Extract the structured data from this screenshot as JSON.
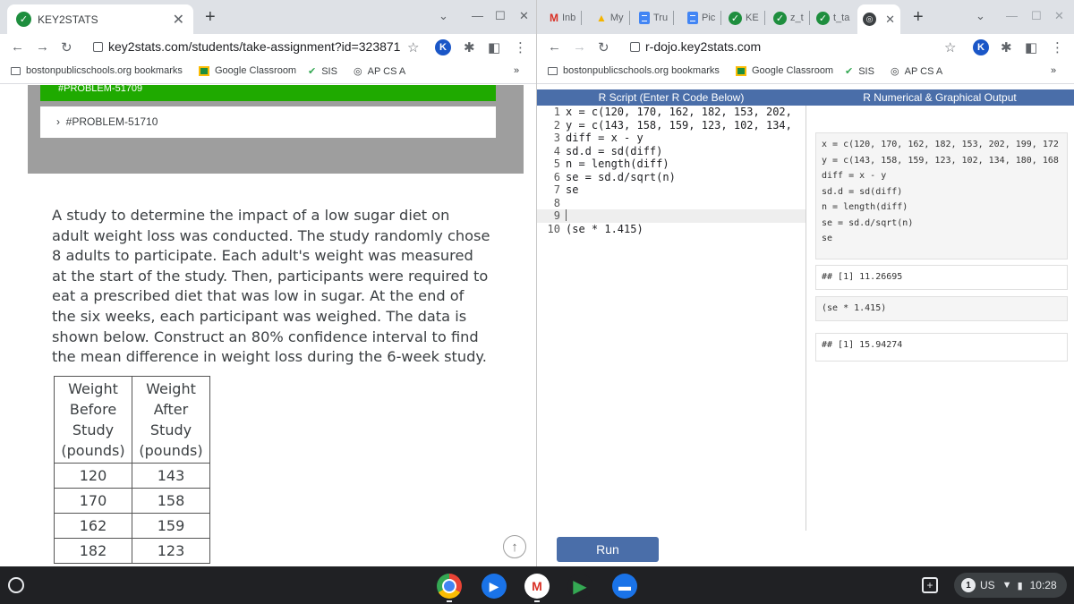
{
  "left_window": {
    "tab_title": "KEY2STATS",
    "url": "key2stats.com/students/take-assignment?id=323871",
    "bookmarks": [
      "bostonpublicschools.org bookmarks",
      "Google Classroom",
      "SIS",
      "AP CS A"
    ],
    "problem_prev_label": "#PROBLEM-51709",
    "problem_label": "#PROBLEM-51710",
    "question_text": "A study to determine the impact of a low sugar diet on adult weight loss was conducted. The study randomly chose 8 adults to participate. Each adult's weight was measured at the start of the study. Then, participants were required to eat a prescribed diet that was low in sugar. At the end of the six weeks, each participant was weighed. The data is shown below. Construct an 80% confidence interval to find the mean difference in weight loss during the 6-week study.",
    "table": {
      "headers": [
        "Weight Before Study (pounds)",
        "Weight After Study (pounds)"
      ],
      "rows": [
        [
          "120",
          "143"
        ],
        [
          "170",
          "158"
        ],
        [
          "162",
          "159"
        ],
        [
          "182",
          "123"
        ]
      ]
    }
  },
  "right_window": {
    "tabs": [
      "Inb",
      "My",
      "Tru",
      "Pic",
      "KE",
      "z_t",
      "t_ta"
    ],
    "url": "r-dojo.key2stats.com",
    "bookmarks": [
      "bostonpublicschools.org bookmarks",
      "Google Classroom",
      "SIS",
      "AP CS A"
    ],
    "script_header": "R Script (Enter R Code Below)",
    "output_header": "R Numerical & Graphical Output",
    "code_lines": [
      "x = c(120, 170, 162, 182, 153, 202,",
      "y = c(143, 158, 159, 123, 102, 134,",
      "diff = x - y",
      "sd.d = sd(diff)",
      "n = length(diff)",
      "se = sd.d/sqrt(n)",
      "se",
      "",
      "",
      "(se * 1.415)"
    ],
    "output_blocks": [
      "x = c(120, 170, 162, 182, 153, 202, 199, 172\ny = c(143, 158, 159, 123, 102, 134, 180, 168\ndiff = x - y\nsd.d = sd(diff)\nn = length(diff)\nse = sd.d/sqrt(n)\nse",
      "## [1] 11.26695",
      "(se * 1.415)",
      "## [1] 15.94274"
    ],
    "run_label": "Run"
  },
  "shelf": {
    "ime": "US",
    "notification_count": "1",
    "time": "10:28"
  }
}
